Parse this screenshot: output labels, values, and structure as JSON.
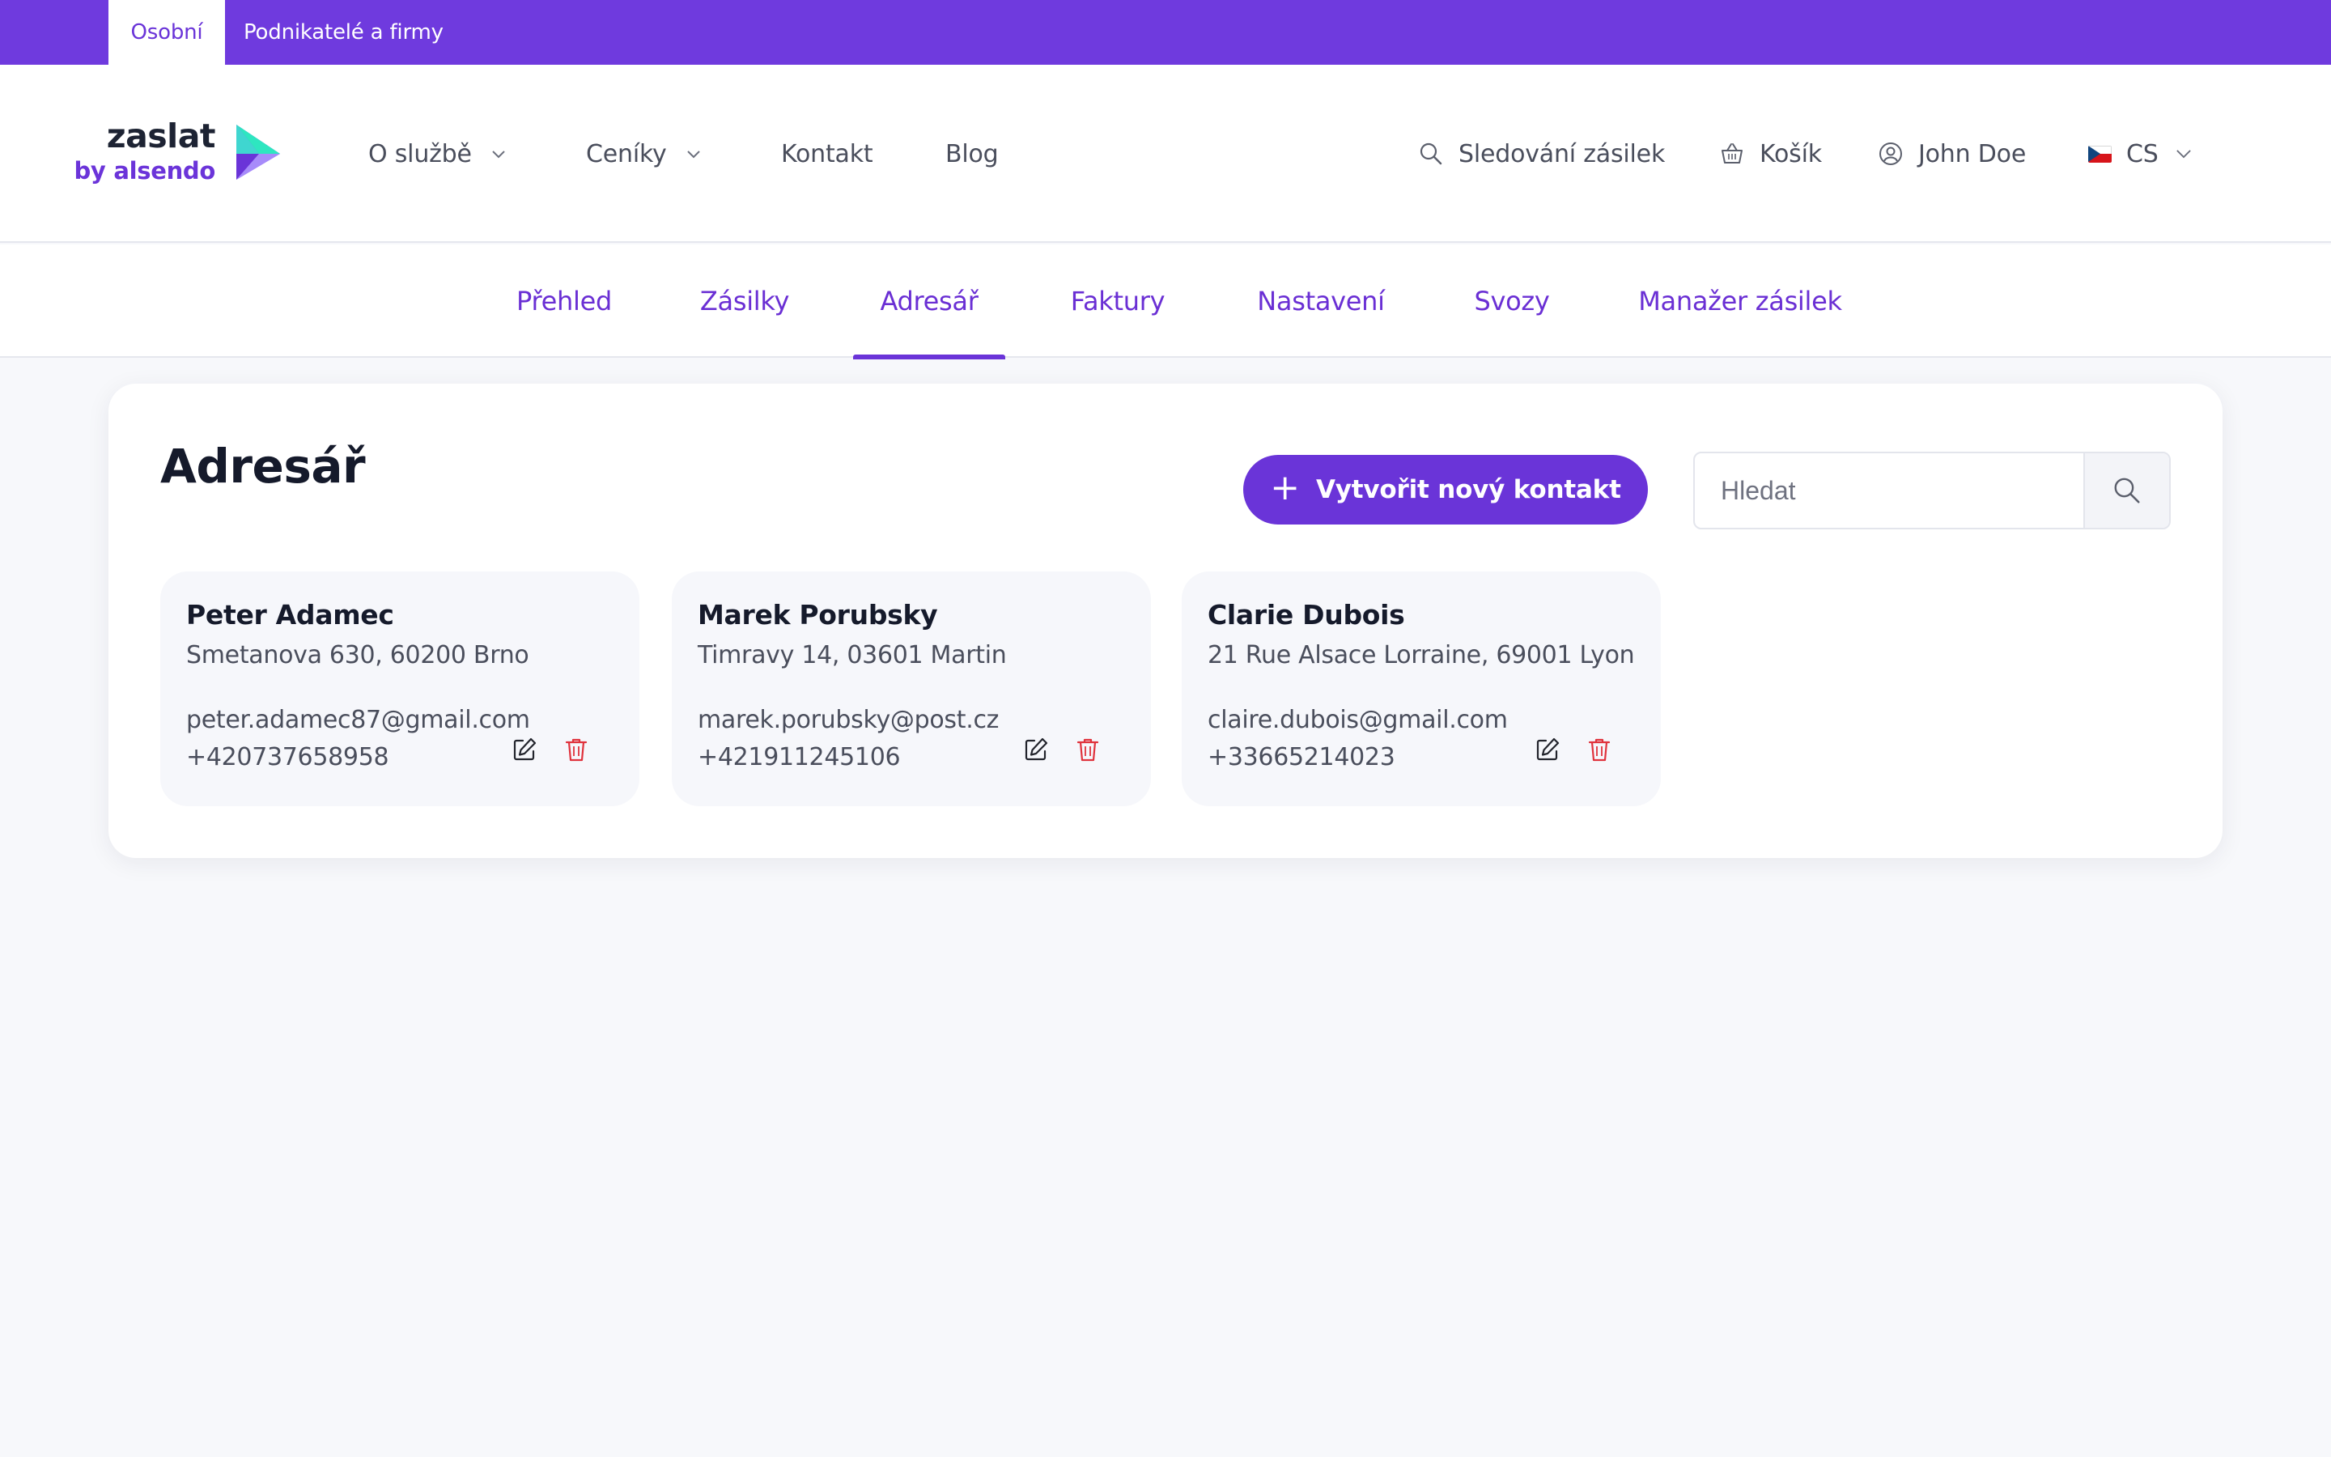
{
  "segment_tabs": {
    "personal": "Osobní",
    "business": "Podnikatelé a firmy"
  },
  "logo": {
    "name": "zaslat",
    "tagline": "by alsendo"
  },
  "main_nav": {
    "about": "O službě",
    "pricing": "Ceníky",
    "contact": "Kontakt",
    "blog": "Blog"
  },
  "utilities": {
    "tracking": "Sledování zásilek",
    "cart": "Košík",
    "user": "John Doe",
    "language": "CS"
  },
  "sub_nav": {
    "overview": "Přehled",
    "shipments": "Zásilky",
    "address_book": "Adresář",
    "invoices": "Faktury",
    "settings": "Nastavení",
    "pickups": "Svozy",
    "shipment_manager": "Manažer zásilek",
    "active": "Adresář"
  },
  "main": {
    "title": "Adresář",
    "create_button": "Vytvořit nový kontakt",
    "create_plus": "+",
    "search_placeholder": "Hledat",
    "search_value": ""
  },
  "contacts": [
    {
      "name": "Peter Adamec",
      "address": "Smetanova 630, 60200 Brno",
      "email": "peter.adamec87@gmail.com",
      "phone": "+420737658958"
    },
    {
      "name": "Marek Porubsky",
      "address": "Timravy 14, 03601 Martin",
      "email": "marek.porubsky@post.cz",
      "phone": "+421911245106"
    },
    {
      "name": "Clarie Dubois",
      "address": "21 Rue Alsace Lorraine, 69001 Lyon",
      "email": "claire.dubois@gmail.com",
      "phone": "+33665214023"
    }
  ],
  "colors": {
    "brand_purple": "#6f3ade",
    "accent_purple": "#6a34d8",
    "delete_red": "#e0323c",
    "page_background": "#f7f8fb"
  }
}
